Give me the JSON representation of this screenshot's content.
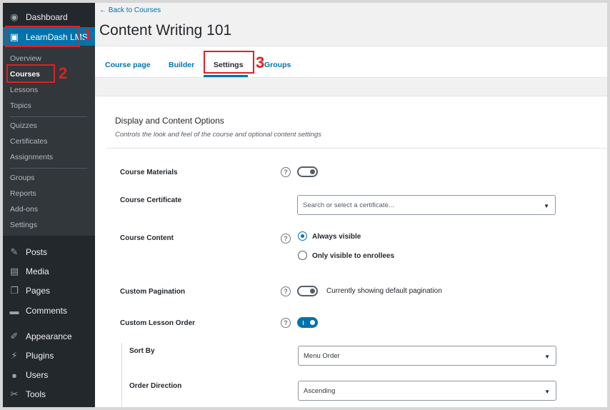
{
  "sidebar": {
    "top_items": [
      {
        "label": "Dashboard",
        "icon": "dashboard-icon",
        "glyph": "◉"
      },
      {
        "label": "LearnDash LMS",
        "icon": "learndash-icon",
        "glyph": "▣"
      }
    ],
    "learndash_submenu": [
      "Overview",
      "Courses",
      "Lessons",
      "Topics",
      "Quizzes",
      "Certificates",
      "Assignments",
      "Groups",
      "Reports",
      "Add-ons",
      "Settings"
    ],
    "bottom_items": [
      {
        "label": "Posts",
        "icon": "pin-icon",
        "glyph": "✎"
      },
      {
        "label": "Media",
        "icon": "media-icon",
        "glyph": "▤"
      },
      {
        "label": "Pages",
        "icon": "pages-icon",
        "glyph": "❐"
      },
      {
        "label": "Comments",
        "icon": "comments-icon",
        "glyph": "▬"
      },
      {
        "label": "Appearance",
        "icon": "brush-icon",
        "glyph": "✐"
      },
      {
        "label": "Plugins",
        "icon": "plugin-icon",
        "glyph": "⚡"
      },
      {
        "label": "Users",
        "icon": "users-icon",
        "glyph": "●"
      },
      {
        "label": "Tools",
        "icon": "wrench-icon",
        "glyph": "✂"
      }
    ]
  },
  "header": {
    "back_link": "← Back to Courses",
    "title": "Content Writing 101"
  },
  "tabs": [
    "Course page",
    "Builder",
    "Settings",
    "Groups"
  ],
  "panel": {
    "title": "Display and Content Options",
    "subtitle": "Controls the look and feel of the course and optional content settings"
  },
  "settings": {
    "course_materials": {
      "label": "Course Materials",
      "enabled": false
    },
    "course_certificate": {
      "label": "Course Certificate",
      "placeholder": "Search or select a certificate..."
    },
    "course_content": {
      "label": "Course Content",
      "options": [
        "Always visible",
        "Only visible to enrollees"
      ],
      "selected": "Always visible"
    },
    "custom_pagination": {
      "label": "Custom Pagination",
      "enabled": false,
      "status_text": "Currently showing default pagination"
    },
    "custom_lesson_order": {
      "label": "Custom Lesson Order",
      "enabled": true
    },
    "sort_by": {
      "label": "Sort By",
      "value": "Menu Order"
    },
    "order_direction": {
      "label": "Order Direction",
      "value": "Ascending"
    }
  },
  "help_glyph": "?",
  "caret_glyph": "▼",
  "annotations": [
    "1",
    "2",
    "3"
  ],
  "colors": {
    "sidebar_bg": "#23282d",
    "submenu_bg": "#32373c",
    "accent": "#0073aa",
    "annotation": "#e02020"
  }
}
